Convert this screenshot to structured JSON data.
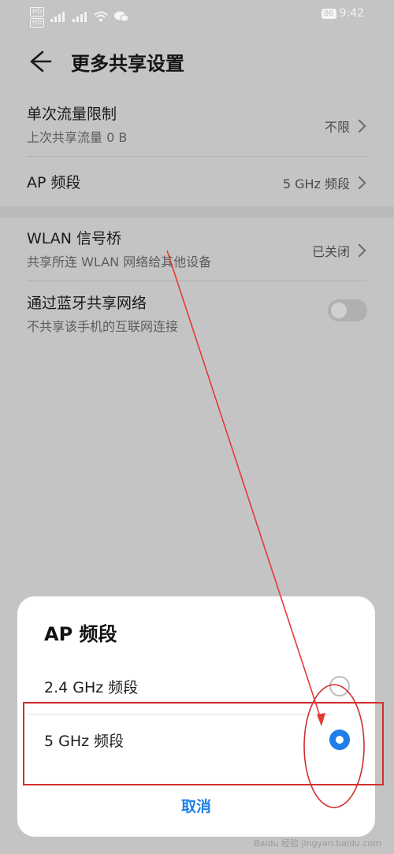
{
  "status_bar": {
    "left_chips": [
      "HD",
      "HD"
    ],
    "signal_labels": [
      "⁴⁶",
      "⁴⁶"
    ],
    "battery": "86",
    "time": "9:42"
  },
  "app_bar": {
    "title": "更多共享设置"
  },
  "settings": {
    "data_limit": {
      "title": "单次流量限制",
      "subtitle": "上次共享流量 0 B",
      "value": "不限"
    },
    "ap_band": {
      "title": "AP 频段",
      "value": "5 GHz 频段"
    },
    "wlan_bridge": {
      "title": "WLAN 信号桥",
      "subtitle": "共享所连 WLAN 网络给其他设备",
      "value": "已关闭"
    },
    "bluetooth_share": {
      "title": "通过蓝牙共享网络",
      "subtitle": "不共享该手机的互联网连接",
      "enabled": false
    }
  },
  "dialog": {
    "title": "AP 频段",
    "options": [
      {
        "label": "2.4 GHz 频段",
        "selected": false
      },
      {
        "label": "5 GHz 频段",
        "selected": true
      }
    ],
    "cancel_label": "取消"
  },
  "annotation_colors": {
    "arrow": "#e53935",
    "box": "#d32f2f"
  },
  "watermark": "Baidu 经验\njingyan.baidu.com"
}
